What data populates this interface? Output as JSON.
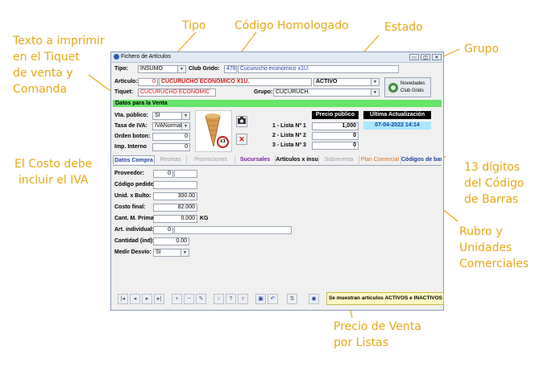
{
  "annotations": {
    "tipo": "Tipo",
    "codigo_homologado": "Código Homologado",
    "estado": "Estado",
    "grupo": "Grupo",
    "texto_imprimir": [
      "Texto a imprimir",
      "en el Tiquet",
      "de venta y",
      "Comanda"
    ],
    "costo_iva": [
      "El Costo debe",
      "incluir el IVA"
    ],
    "digitos": [
      "13 dígitos",
      "del Código",
      "de Barras"
    ],
    "rubro": [
      "Rubro y",
      "Unidades",
      "Comerciales"
    ],
    "precio_venta": [
      "Precio de Venta",
      "por Listas"
    ]
  },
  "window": {
    "title": "Fichero de Artículos",
    "buttons": [
      "▭",
      "◫",
      "✕"
    ]
  },
  "header": {
    "tipo_label": "Tipo:",
    "tipo_value": "INSUMO",
    "club_label": "Club Grido:",
    "club_code": "478",
    "club_desc": "Cucurucho económico x1U.",
    "articulo_label": "Artículo:",
    "articulo_code": "0",
    "articulo_name": "CUCURUCHO ECONÓMICO X1U.",
    "estado_value": "ACTIVO",
    "tiquet_label": "Tiquet:",
    "tiquet_value": "CUCURUCHO ECONÓMIC",
    "grupo_label": "Grupo:",
    "grupo_value": "CUCURUCH.",
    "novedades_label": [
      "Novedades",
      "Club Grido"
    ]
  },
  "venta": {
    "section_title": "Datos para la Venta",
    "vta_publico_label": "Vta. público:",
    "vta_publico_value": "SI",
    "tasa_iva_label": "Tasa de IVA:",
    "tasa_iva_value": "IVANormal",
    "orden_label": "Orden boton:",
    "orden_value": "0",
    "imp_interno_label": "Imp. Interno",
    "imp_interno_value": "0",
    "badge": "x1",
    "precio_header": "Precio público",
    "listas": [
      {
        "label": "1 - Lista Nº 1",
        "value": "1,000"
      },
      {
        "label": "2 - Lista Nº 2",
        "value": "0"
      },
      {
        "label": "3 - Lista Nº 3",
        "value": "0"
      }
    ],
    "ultima_header": "Última Actualización",
    "ultima_value": "07-04-2022 14:14"
  },
  "tabs": [
    {
      "label": "Datos Compra",
      "color": "#1d3f9e"
    },
    {
      "label": "Recetas",
      "color": "#9aa0a8"
    },
    {
      "label": "Promociones",
      "color": "#9aa0a8"
    },
    {
      "label": "Sucursales",
      "color": "#7a1fa0"
    },
    {
      "label": "Artículos x insu",
      "color": "#000000"
    },
    {
      "label": "Sobreventa",
      "color": "#9aa0a8"
    },
    {
      "label": "Plan Comercial",
      "color": "#e07010"
    },
    {
      "label": "Códigos de barra",
      "color": "#1d3f9e"
    }
  ],
  "compra": {
    "proveedor_label": "Proveedor:",
    "proveedor_value": "0",
    "codigo_pedido_label": "Código pedido:",
    "unid_bulto_label": "Unid. x Bulto:",
    "unid_bulto_value": "300.00",
    "costo_final_label": "Costo final:",
    "costo_final_value": "82.000",
    "cant_prima_label": "Cant. M. Prima:",
    "cant_prima_value": "0.000",
    "cant_prima_unit": "KG",
    "art_individual_label": "Art. individual:",
    "art_individual_value": "0",
    "cantidad_ind_label": "Cantidad (ind):",
    "cantidad_ind_value": "0.00",
    "medir_desvio_label": "Medir Desvío:",
    "medir_desvio_value": "SI"
  },
  "status_text": "Se muestran artículos ACTIVOS e INACTIVOS",
  "colors": {
    "annotation": "#e6a817",
    "green_bar": "#68e468",
    "red_text": "#d01515"
  }
}
